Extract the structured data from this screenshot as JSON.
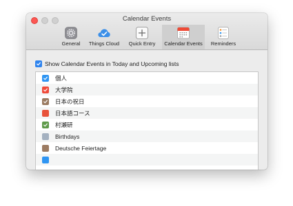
{
  "window": {
    "title": "Calendar Events"
  },
  "tabs": [
    {
      "label": "General",
      "icon": "gear-icon",
      "active": false
    },
    {
      "label": "Things Cloud",
      "icon": "cloud-check-icon",
      "active": false
    },
    {
      "label": "Quick Entry",
      "icon": "plus-square-icon",
      "active": false
    },
    {
      "label": "Calendar Events",
      "icon": "calendar-icon",
      "active": true
    },
    {
      "label": "Reminders",
      "icon": "checklist-icon",
      "active": false
    }
  ],
  "show_option": {
    "label": "Show Calendar Events in Today and Upcoming lists",
    "checked": true,
    "color": "#2f84ee"
  },
  "calendars": [
    {
      "name": "個人",
      "color": "#2f95f2",
      "checked": true
    },
    {
      "name": "大学院",
      "color": "#ef4a39",
      "checked": true
    },
    {
      "name": "日本の祝日",
      "color": "#9a7a60",
      "checked": true
    },
    {
      "name": "日本語コース",
      "color": "#e8523a",
      "checked": false
    },
    {
      "name": "村瀬研",
      "color": "#5f9a4a",
      "checked": true
    },
    {
      "name": "Birthdays",
      "color": "#a4b1c0",
      "checked": false
    },
    {
      "name": "Deutsche Feiertage",
      "color": "#9c7b62",
      "checked": false
    },
    {
      "name": "",
      "color": "#2f95f2",
      "checked": false
    }
  ]
}
